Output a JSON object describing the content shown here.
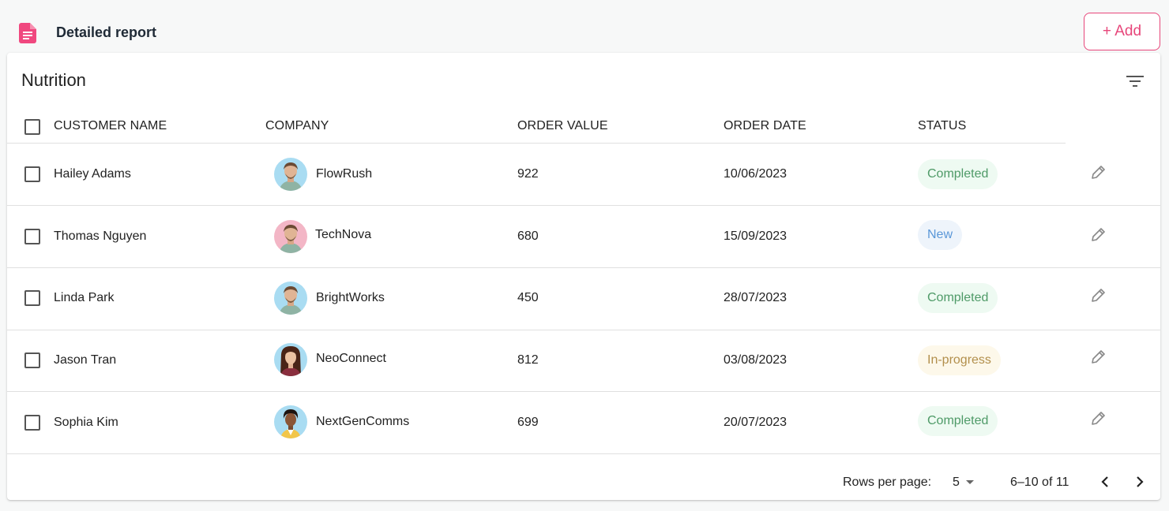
{
  "header": {
    "title": "Detailed report",
    "add_label": "+ Add"
  },
  "card": {
    "title": "Nutrition"
  },
  "columns": [
    "CUSTOMER NAME",
    "COMPANY",
    "ORDER VALUE",
    "ORDER DATE",
    "STATUS"
  ],
  "rows": [
    {
      "name": "Hailey Adams",
      "company": "FlowRush",
      "value": "922",
      "date": "10/06/2023",
      "status": "Completed"
    },
    {
      "name": "Thomas Nguyen",
      "company": "TechNova",
      "value": "680",
      "date": "15/09/2023",
      "status": "New"
    },
    {
      "name": "Linda Park",
      "company": "BrightWorks",
      "value": "450",
      "date": "28/07/2023",
      "status": "Completed"
    },
    {
      "name": "Jason Tran",
      "company": "NeoConnect",
      "value": "812",
      "date": "03/08/2023",
      "status": "In-progress"
    },
    {
      "name": "Sophia Kim",
      "company": "NextGenComms",
      "value": "699",
      "date": "20/07/2023",
      "status": "Completed"
    }
  ],
  "footer": {
    "rows_per_page_label": "Rows per page:",
    "rows_per_page": "5",
    "range": "6–10 of 11"
  },
  "colors": {
    "accent": "#e7467a",
    "completed": "#4e9a67",
    "new": "#5a97d8",
    "in_progress": "#b28f4c"
  },
  "icons": {
    "header": "document-icon",
    "filter": "filter-icon",
    "edit": "pencil-icon",
    "prev": "chevron-left-icon",
    "next": "chevron-right-icon"
  }
}
